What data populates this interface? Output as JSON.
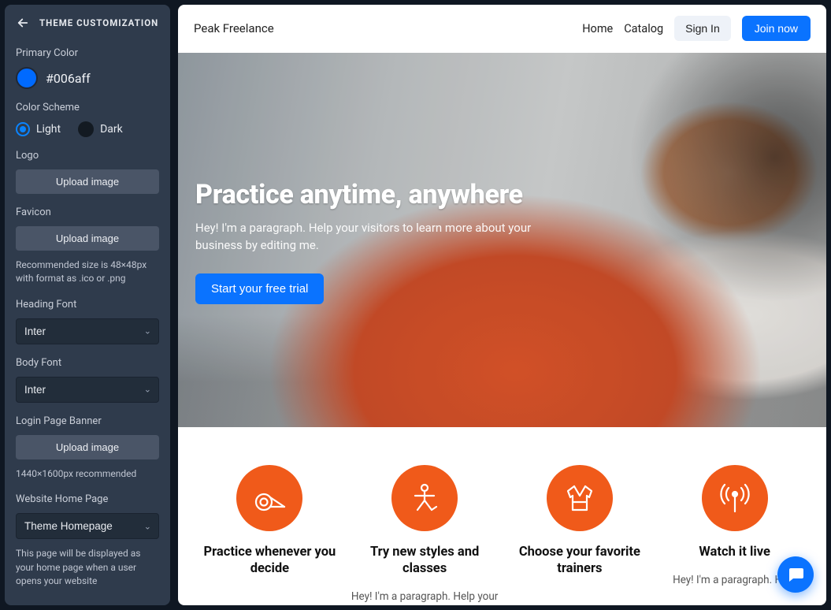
{
  "sidebar": {
    "title": "THEME CUSTOMIZATION",
    "primary_color_label": "Primary Color",
    "primary_color_hex": "#006aff",
    "color_scheme_label": "Color Scheme",
    "scheme_light": "Light",
    "scheme_dark": "Dark",
    "logo_label": "Logo",
    "upload_label": "Upload image",
    "favicon_label": "Favicon",
    "favicon_hint": "Recommended size is 48×48px with format as .ico or .png",
    "heading_font_label": "Heading Font",
    "heading_font_value": "Inter",
    "body_font_label": "Body Font",
    "body_font_value": "Inter",
    "login_banner_label": "Login Page Banner",
    "login_banner_hint": "1440×1600px recommended",
    "home_page_label": "Website Home Page",
    "home_page_value": "Theme Homepage",
    "home_page_hint": "This page will be displayed as your home page when a user opens your website"
  },
  "preview": {
    "brand": "Peak Freelance",
    "nav": {
      "home": "Home",
      "catalog": "Catalog",
      "sign_in": "Sign In",
      "join": "Join now"
    },
    "hero": {
      "title": "Practice anytime, anywhere",
      "subtitle": "Hey! I'm a paragraph. Help your visitors to learn more about your business by editing me.",
      "cta": "Start your free trial"
    },
    "features": [
      {
        "title": "Practice whenever you decide",
        "sub": ""
      },
      {
        "title": "Try new styles and classes",
        "sub": "Hey! I'm a paragraph. Help your"
      },
      {
        "title": "Choose your favorite trainers",
        "sub": ""
      },
      {
        "title": "Watch it live",
        "sub": "Hey! I'm a paragraph. Help"
      }
    ]
  },
  "colors": {
    "accent": "#0a73ff",
    "feature_icon": "#f05a1a"
  }
}
